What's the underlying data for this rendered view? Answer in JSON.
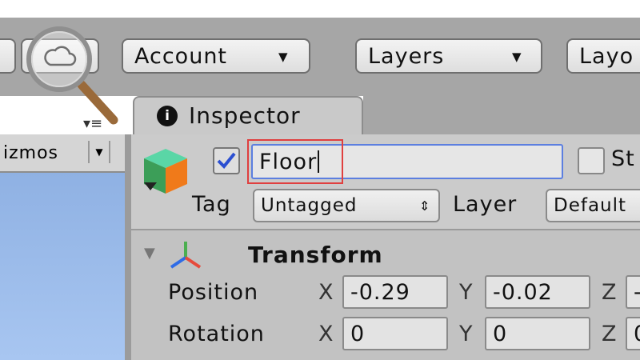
{
  "toolbar": {
    "account_label": "Account",
    "layers_label": "Layers",
    "layout_label": "Layo"
  },
  "left_panel": {
    "gizmos_label": "izmos"
  },
  "inspector": {
    "tab_label": "Inspector",
    "object": {
      "active": true,
      "name": "Floor",
      "static_label": "St",
      "tag_label": "Tag",
      "tag_value": "Untagged",
      "layer_label": "Layer",
      "layer_value": "Default"
    },
    "transform": {
      "title": "Transform",
      "position": {
        "label": "Position",
        "x": "-0.29",
        "y": "-0.02",
        "z": "-"
      },
      "rotation": {
        "label": "Rotation",
        "x": "0",
        "y": "0",
        "z": "0"
      }
    }
  },
  "icons": [
    "cloud-icon",
    "magnifier-icon",
    "info-icon",
    "gameobject-cube-icon",
    "transform-axes-icon"
  ],
  "colors": {
    "selection_box": "#e0403f",
    "focused_field": "#5c7fe0",
    "scene_bg": "#9dbdee"
  }
}
